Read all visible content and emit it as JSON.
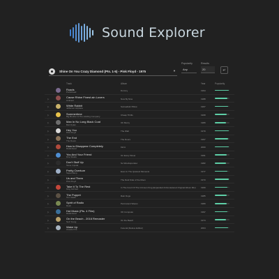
{
  "app": {
    "title": "Sound Explorer",
    "wave_levels": [
      0.35,
      0.6,
      0.85,
      1.0,
      0.75,
      0.95,
      0.7,
      0.5,
      0.3
    ],
    "colors": {
      "background": "#212121",
      "accent": "#5ecfa7",
      "wave_start": "#3f7fd0",
      "wave_end": "#9ec8e8"
    }
  },
  "search": {
    "value": "Shine On You Crazy Diamond (Pts. 1-5) - Pink Floyd - 1975",
    "popularity_label": "Popularity",
    "popularity_value": "Any",
    "results_label": "Results",
    "results_value": "20"
  },
  "table": {
    "headers": {
      "track": "Track",
      "album": "Album",
      "year": "Year",
      "popularity": "Popularity"
    },
    "rows": [
      {
        "play": "",
        "title": "Roads",
        "artist": "Portishead",
        "album": "Dummy",
        "year": "1994",
        "popularity": 0.95,
        "art": "#7b6a8e"
      },
      {
        "play": "▷",
        "title": "Cause Rhine Finest ain Lovers",
        "artist": "Ambient",
        "album": "Now By Nine",
        "year": "1988",
        "popularity": 0.88,
        "art": "#8f4e4e"
      },
      {
        "play": "▷",
        "title": "White Rabbit",
        "artist": "Jefferson Airplane",
        "album": "Surrealistic Pillow",
        "year": "1967",
        "popularity": 0.9,
        "art": "#c9b26a"
      },
      {
        "play": "▷",
        "title": "Summertime",
        "artist": "Big Brother & The Holding Company",
        "album": "Cheap Thrills",
        "year": "1968",
        "popularity": 0.82,
        "art": "#e8c24b"
      },
      {
        "play": "▷",
        "title": "Man In No Long Black Coat",
        "artist": "Bob Dylan",
        "album": "Oh Mercy",
        "year": "1989",
        "popularity": 0.78,
        "art": "#6d6d6d"
      },
      {
        "play": "▷",
        "title": "Hey You",
        "artist": "Pink Floyd",
        "album": "The Wall",
        "year": "1979",
        "popularity": 0.97,
        "art": "#d9d9d9"
      },
      {
        "play": "▷",
        "title": "The End",
        "artist": "The Doors",
        "album": "The Doors",
        "year": "1967",
        "popularity": 0.92,
        "art": "#8a7258"
      },
      {
        "play": "▷",
        "title": "How to Disappear Completely",
        "artist": "Radiohead",
        "album": "Kid A",
        "year": "2000",
        "popularity": 0.94,
        "art": "#b04a3c"
      },
      {
        "play": "▷",
        "title": "You And Your Friend",
        "artist": "Dire Straits",
        "album": "On Every Street",
        "year": "1991",
        "popularity": 0.8,
        "art": "#4f8ed2"
      },
      {
        "play": "▷",
        "title": "Don't Stuff Up",
        "artist": "Tame Impala",
        "album": "So Wrecksponded",
        "year": "1982",
        "popularity": 0.75,
        "art": "#2c2c2c"
      },
      {
        "play": "▷",
        "title": "Pretty Overture",
        "artist": "Supertramp",
        "album": "Even In The Quietest Moments",
        "year": "1977",
        "popularity": 0.84,
        "art": "#9fb0c7"
      },
      {
        "play": "▷",
        "title": "Us and Them",
        "artist": "Pink Floyd",
        "album": "The Dark Side of the Moon",
        "year": "1973",
        "popularity": 0.93,
        "art": "#1b1b1b"
      },
      {
        "play": "▷",
        "title": "Take It To The Rest",
        "artist": "King Gizzard",
        "album": "In The Court Of The Crimson King (Expanded & Remastered Original Album Mix)",
        "year": "1969",
        "popularity": 0.86,
        "art": "#c4473a"
      },
      {
        "play": "▷",
        "title": "The Puppet",
        "artist": "Tom Waits",
        "album": "Rain Dogs",
        "year": "1985",
        "popularity": 0.79,
        "art": "#5b5144"
      },
      {
        "play": "▷",
        "title": "Spirit of Radio",
        "artist": "Rush",
        "album": "Permanent Waves",
        "year": "1980",
        "popularity": 0.8,
        "art": "#7a8a52"
      },
      {
        "play": "▷",
        "title": "Hot Music (Pts. 4 Film)",
        "artist": "Radiohead",
        "album": "OK Computer",
        "year": "1997",
        "popularity": 0.85,
        "art": "#3a6f9a"
      },
      {
        "play": "▷",
        "title": "On the Beach - 2016 Remaster",
        "artist": "Neil Young",
        "album": "On the Beach",
        "year": "1974",
        "popularity": 0.77,
        "art": "#b8a16b"
      },
      {
        "play": "▷",
        "title": "Wake Up",
        "artist": "Arcade Fire",
        "album": "Funeral (Deluxe Edition)",
        "year": "2004",
        "popularity": 0.89,
        "art": "#a8b4c0"
      }
    ]
  }
}
